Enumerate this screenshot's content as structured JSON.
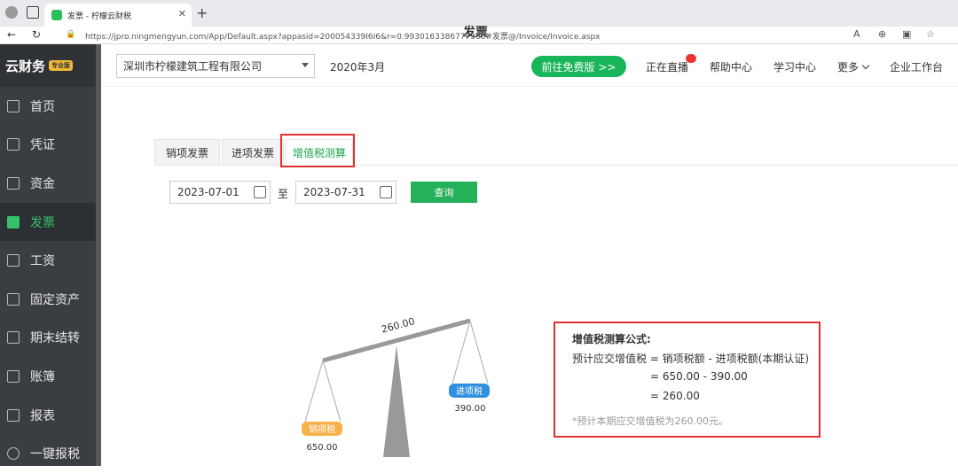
{
  "browser": {
    "tab_title": "发票 - 柠檬云财税",
    "url": "https://jpro.ningmengyun.com/App/Default.aspx?appasid=200054339I6I6&r=0.9930163386777366#发票@/Invoice/Invoice.aspx"
  },
  "sidebar": {
    "logo": "云财务",
    "badge": "专业版",
    "items": [
      {
        "label": "首页"
      },
      {
        "label": "凭证"
      },
      {
        "label": "资金"
      },
      {
        "label": "发票"
      },
      {
        "label": "工资"
      },
      {
        "label": "固定资产"
      },
      {
        "label": "期末结转"
      },
      {
        "label": "账簿"
      },
      {
        "label": "报表"
      },
      {
        "label": "一键报税"
      }
    ]
  },
  "header": {
    "company": "深圳市柠檬建筑工程有限公司",
    "period": "2020年3月",
    "free_btn": "前往免费版 >>",
    "live": "正在直播",
    "help": "帮助中心",
    "study": "学习中心",
    "more": "更多",
    "workbench": "企业工作台"
  },
  "page": {
    "title": "发票",
    "tabs": [
      "销项发票",
      "进项发票",
      "增值税测算"
    ]
  },
  "filter": {
    "start": "2023-07-01",
    "to": "至",
    "end": "2023-07-31",
    "query": "查询"
  },
  "scale": {
    "diff": "260.00",
    "output_label": "销项税",
    "output_value": "650.00",
    "input_label": "进项税",
    "input_value": "390.00"
  },
  "formula": {
    "title": "增值税测算公式:",
    "line1": "预计应交增值税 = 销项税额 - 进项税额(本期认证)",
    "line2": "= 650.00 - 390.00",
    "line3": "= 260.00",
    "note": "*预计本期应交增值税为260.00元。"
  },
  "colors": {
    "accent": "#19b55a",
    "highlight": "#e03030",
    "sidebar": "#3a3e42"
  }
}
